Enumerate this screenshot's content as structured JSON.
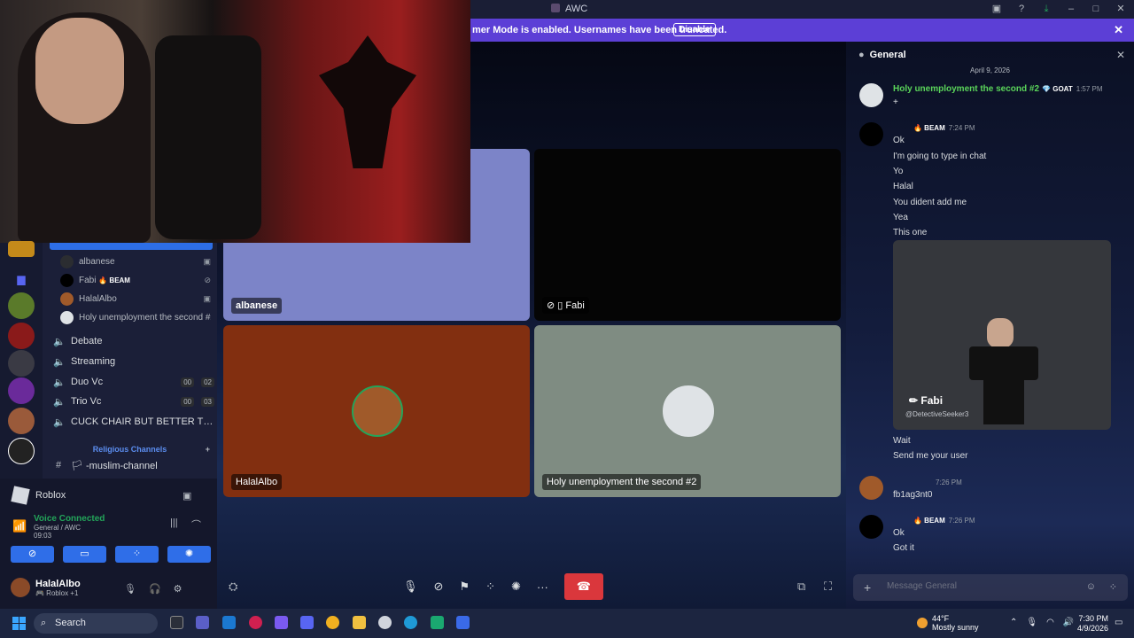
{
  "window": {
    "title": "AWC"
  },
  "banner": {
    "text": "mer Mode is enabled. Usernames have been truncated.",
    "disable_label": "Disable"
  },
  "sidebar": {
    "voice_members": [
      {
        "name": "albanese",
        "beam": ""
      },
      {
        "name": "Fabi",
        "beam": "🔥 BEAM"
      },
      {
        "name": "HalalAlbo",
        "beam": ""
      },
      {
        "name": "Holy unemployment the second #2",
        "beam": ""
      }
    ],
    "channels": [
      {
        "name": "Debate"
      },
      {
        "name": "Streaming"
      },
      {
        "name": "Duo Vc",
        "count_a": "00",
        "count_b": "02"
      },
      {
        "name": "Trio Vc",
        "count_a": "00",
        "count_b": "03"
      },
      {
        "name": "CUCK CHAIR BUT BETTER TH..."
      }
    ],
    "category": "Religious Channels",
    "text_channel": "🏳 -muslim-channel"
  },
  "activity": {
    "game": "Roblox"
  },
  "voice": {
    "status": "Voice Connected",
    "location": "General / AWC",
    "timer": "09:03"
  },
  "user": {
    "name": "HalalAlbo",
    "status": "🎮 Roblox +1"
  },
  "tiles": [
    {
      "label": "albanese"
    },
    {
      "label": "Fabi"
    },
    {
      "label": "HalalAlbo"
    },
    {
      "label": "Holy unemployment the second #2"
    }
  ],
  "chat": {
    "channel": "General",
    "date": "April 9, 2026",
    "first": {
      "author": "Holy unemployment the second #2",
      "tag": "💎 GOAT",
      "time": "1:57 PM",
      "text": "+"
    },
    "fabi_block": {
      "tag": "🔥 BEAM",
      "time": "7:24 PM",
      "lines": [
        "Ok",
        "I'm going to type in chat",
        "Yo",
        "Halal",
        "You dident add me",
        "Yea",
        "This one"
      ]
    },
    "embed": {
      "name": "✏ Fabi",
      "user": "@DetectiveSeeker3"
    },
    "after_embed": [
      "Wait",
      "Send me your user"
    ],
    "halal_msg": {
      "time": "7:26 PM",
      "text": "fb1ag3nt0"
    },
    "last": {
      "tag": "🔥 BEAM",
      "time": "7:26 PM",
      "lines": [
        "Ok",
        "Got it"
      ]
    },
    "composer_placeholder": "Message General"
  },
  "taskbar": {
    "search": "Search",
    "weather_temp": "44°F",
    "weather_desc": "Mostly sunny",
    "time": "7:30 PM",
    "date": "4/9/2026"
  },
  "colors": {
    "accent": "#5865f2",
    "green": "#23a55a",
    "danger": "#da373c",
    "banner": "#5c3fd6"
  }
}
